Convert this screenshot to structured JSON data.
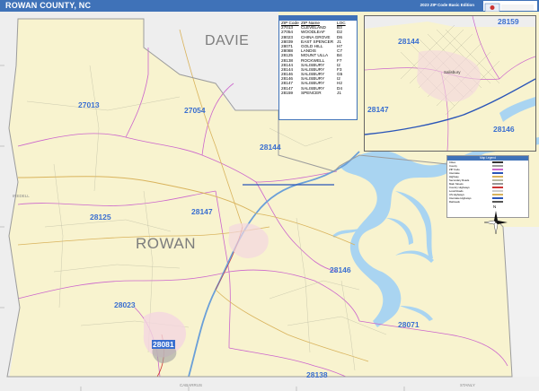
{
  "header": {
    "title": "ROWAN COUNTY, NC",
    "edition": "2023 ZIP Code Basic Edition"
  },
  "colors": {
    "header_bg": "#3f72b8",
    "land": "#f8f3cf",
    "water": "#a9d4f1",
    "zip_label": "#3a6fd0",
    "zip_boundary": "#cc66cc",
    "highway": "#6a9fd8"
  },
  "map": {
    "county_name": "ROWAN",
    "neighbors": {
      "north": "DAVIE",
      "west": "IREDELL",
      "south": "CABARRUS",
      "southeast": "STANLY"
    },
    "zip_labels": [
      "27013",
      "27054",
      "28144",
      "28147",
      "28125",
      "28146",
      "28023",
      "28081",
      "28071",
      "28138"
    ],
    "inset_zip_labels": [
      "28159",
      "28144",
      "28147",
      "28146"
    ],
    "inset_city": "Salisbury"
  },
  "zip_table": {
    "headers": [
      "ZIP Code",
      "ZIP Name",
      "LOC"
    ],
    "rows": [
      [
        "27013",
        "CLEVELAND",
        "B3"
      ],
      [
        "27054",
        "WOODLEAF",
        "D2"
      ],
      [
        "28023",
        "CHINA GROVE",
        "D6"
      ],
      [
        "28039",
        "EAST SPENCER",
        "J1"
      ],
      [
        "28071",
        "GOLD HILL",
        "H7"
      ],
      [
        "28088",
        "LANDIS",
        "C7"
      ],
      [
        "28125",
        "MOUNT ULLA",
        "B4"
      ],
      [
        "28138",
        "ROCKWELL",
        "F7"
      ],
      [
        "28144",
        "SALISBURY",
        "I2"
      ],
      [
        "28144",
        "SALISBURY",
        "F3"
      ],
      [
        "28146",
        "SALISBURY",
        "G5"
      ],
      [
        "28146",
        "SALISBURY",
        "I2"
      ],
      [
        "28147",
        "SALISBURY",
        "H2"
      ],
      [
        "28147",
        "SALISBURY",
        "D4"
      ],
      [
        "28159",
        "SPENCER",
        "J1"
      ]
    ]
  },
  "legend": {
    "title": "Map Legend",
    "items": [
      "Cities",
      "County",
      "ZIP Code",
      "Interstate",
      "Highway",
      "Secondary Roads",
      "Main Streets",
      "Country Highways",
      "Local Roads",
      "US Highways",
      "Interstate Highways",
      "Railroads"
    ]
  }
}
